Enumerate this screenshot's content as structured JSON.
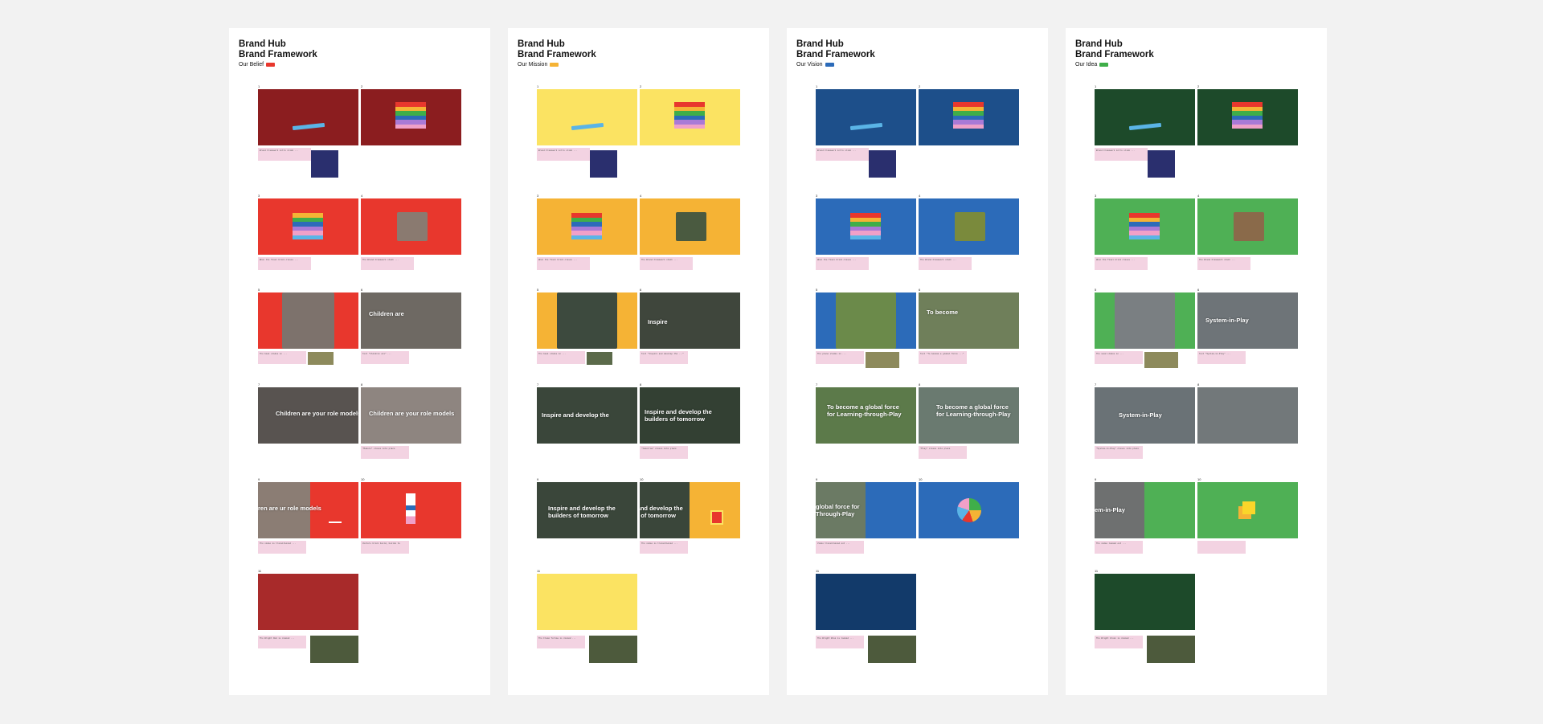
{
  "sheets": [
    {
      "title_line1": "Brand Hub",
      "title_line2": "Brand Framework",
      "subtitle": "Our Belief",
      "accent": "#e8372d",
      "frame_captions": {
        "f6": "Children are",
        "f7": "Children are your role models",
        "f8": "Children are your role models",
        "f9": "ren are ur role models"
      },
      "notes": [
        "Brand Framework intro slide ...",
        "When the final brick closes ...",
        "The Brand Framework stack ...",
        "The book slides in ...",
        "Text \"Children are\" ...",
        "\"Models\" closes into place",
        "The video is transitioned ...",
        "Vectors brick build, builds to",
        "The Bright Red is zoomed ..."
      ]
    },
    {
      "title_line1": "Brand Hub",
      "title_line2": "Brand Framework",
      "subtitle": "Our Mission",
      "accent": "#f5b335",
      "frame_captions": {
        "f6": "Inspire",
        "f7": "Inspire and develop the",
        "f8": "Inspire and develop the builders of tomorrow",
        "f9": "Inspire and develop the builders of tomorrow",
        "f9b": "Inspire and develop the builders of tomorrow"
      },
      "notes": [
        "Brand Framework intro slide ...",
        "When the final brick closes ...",
        "The Brand Framework stack ...",
        "The book slides in ...",
        "Text \"Inspire and develop the ...\"",
        "\"tomorrow\" closes into place",
        "The video is transitioned ...",
        "The Flame Yellow is zoomed ..."
      ]
    },
    {
      "title_line1": "Brand Hub",
      "title_line2": "Brand Framework",
      "subtitle": "Our Vision",
      "accent": "#2c6bb9",
      "frame_captions": {
        "f6": "To become",
        "f7": "To become a global force for Learning-through-Play",
        "f8": "To become a global force for Learning-through-Play",
        "f9": "global force for Through-Play"
      },
      "notes": [
        "Brand Framework intro slide ...",
        "When the final brick closes ...",
        "The Brand Framework stack ...",
        "The plane slides in ...",
        "Text \"To become a global force ...\"",
        "\"Play\" closes into place",
        "Video transitioned out ...",
        "The Bright Blue is zoomed ..."
      ]
    },
    {
      "title_line1": "Brand Hub",
      "title_line2": "Brand Framework",
      "subtitle": "Our Idea",
      "accent": "#3fae49",
      "frame_captions": {
        "f6": "System-in-Play",
        "f7": "System-in-Play",
        "f9": "em-in-Play"
      },
      "notes": [
        "Brand Framework intro slide ...",
        "When the final brick closes ...",
        "The Brand Framework stack ...",
        "The seed slides in ...",
        "Text \"System-in-Play\" ...",
        "\"System-in-Play\" closes into place",
        "The video zoomed out ...",
        "The Bright Green is zoomed ..."
      ]
    }
  ],
  "frame_numbers": [
    "1",
    "2",
    "3",
    "4",
    "5",
    "6",
    "7",
    "8",
    "9",
    "10",
    "11"
  ],
  "colors": {
    "belief": [
      "#8b1d1f",
      "#e8372d",
      "#a82a2a"
    ],
    "mission": [
      "#fbe362",
      "#f5b335",
      "#fbe362"
    ],
    "vision": [
      "#1d4f8a",
      "#2c6bb9",
      "#123a6a"
    ],
    "idea": [
      "#1d4a2a",
      "#4fb055",
      "#1d4a2a"
    ]
  }
}
